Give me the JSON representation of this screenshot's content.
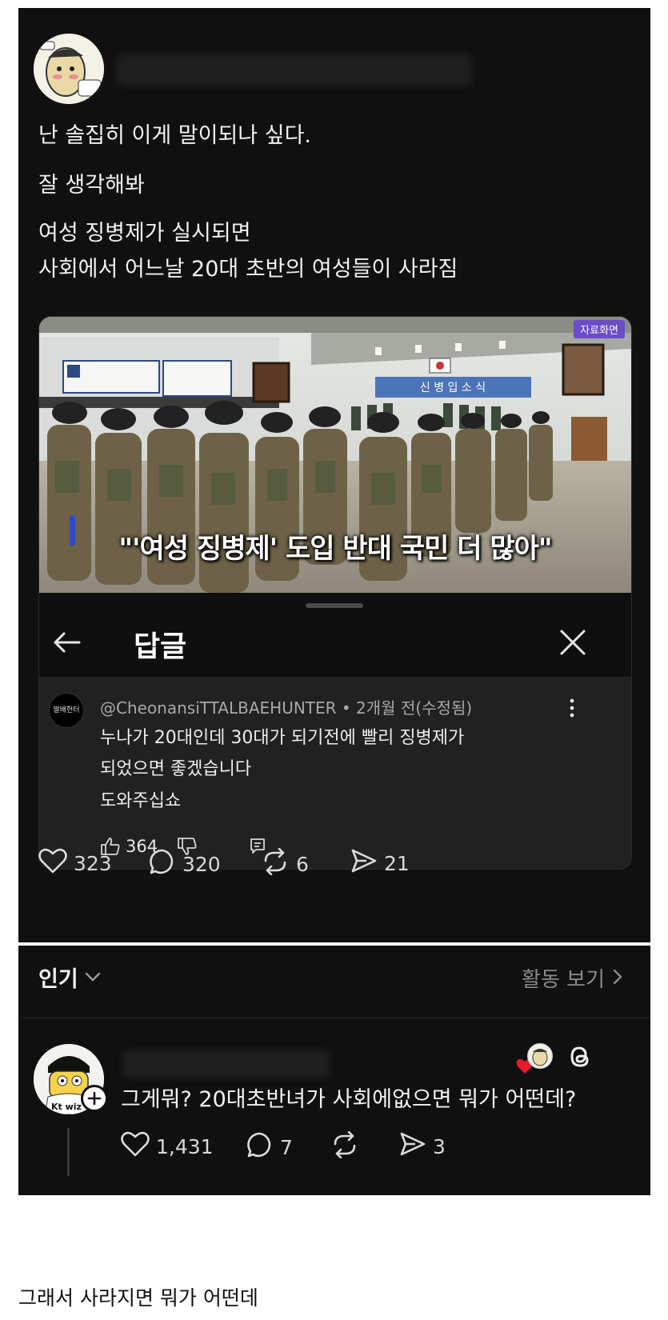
{
  "post": {
    "lines": [
      "난 솔집히 이게 말이되나 싶다.",
      "잘 생각해봐",
      "여성 징병제가 실시되면",
      "사회에서 어느날 20대 초반의 여성들이 사라짐"
    ],
    "stats": {
      "likes": "323",
      "comments": "320",
      "reposts": "6",
      "shares": "21"
    }
  },
  "media": {
    "badge": "자료화면",
    "caption": "\"'여성 징병제' 도입 반대 국민 더 많아\"",
    "banner": "신 병 입 소 식",
    "sheet_title": "답글",
    "comment": {
      "avatar_text": "딸배헌터",
      "handle_line": "@CheonansiTTALBAEHUNTER • 2개월 전(수정됨)",
      "lines": [
        "누나가 20대인데 30대가 되기전에 빨리 징병제가",
        "되었으면 좋겠습니다",
        "도와주십쇼"
      ],
      "likes": "364"
    }
  },
  "replies": {
    "sort_label": "인기",
    "activity_label": "활동 보기",
    "reply": {
      "text": "그게뭐? 20대초반녀가 사회에없으면 뭐가 어떤데?",
      "jersey_text": "Kt wiz",
      "stats": {
        "likes": "1,431",
        "comments": "7",
        "shares": "3"
      }
    }
  },
  "bottom_caption": "그래서 사라지면 뭐가 어떤데"
}
